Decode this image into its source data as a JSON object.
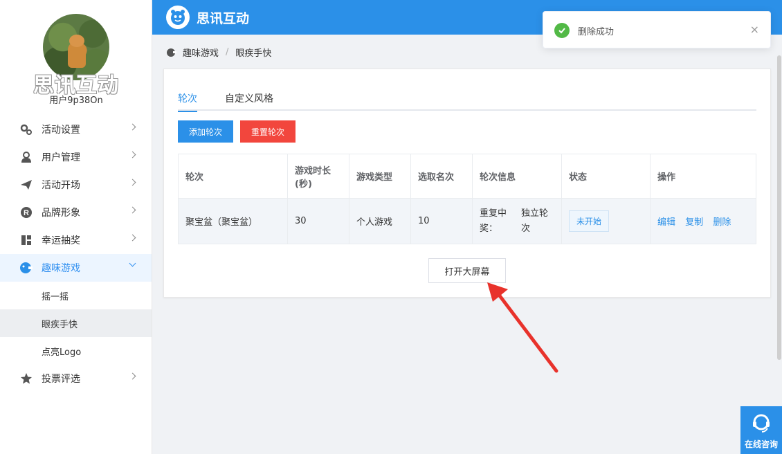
{
  "sidebar": {
    "brand": "思讯互动",
    "username": "用户9p38On",
    "menu": [
      {
        "label": "活动设置",
        "icon": "gears-icon"
      },
      {
        "label": "用户管理",
        "icon": "user-icon"
      },
      {
        "label": "活动开场",
        "icon": "paper-plane-icon"
      },
      {
        "label": "品牌形象",
        "icon": "registered-icon"
      },
      {
        "label": "幸运抽奖",
        "icon": "gift-icon"
      },
      {
        "label": "趣味游戏",
        "icon": "gamepad-icon"
      },
      {
        "label": "投票评选",
        "icon": "star-icon"
      }
    ],
    "submenu": [
      "摇一摇",
      "眼疾手快",
      "点亮Logo"
    ]
  },
  "header": {
    "title": "思讯互动"
  },
  "breadcrumb": {
    "parent": "趣味游戏",
    "separator": "/",
    "current": "眼疾手快"
  },
  "tabs": [
    "轮次",
    "自定义风格"
  ],
  "buttons": {
    "add": "添加轮次",
    "reset": "重置轮次",
    "open_screen": "打开大屏幕"
  },
  "table": {
    "headers": [
      "轮次",
      "游戏时长(秒)",
      "游戏类型",
      "选取名次",
      "轮次信息",
      "状态",
      "操作"
    ],
    "rows": [
      {
        "round": "聚宝盆（聚宝盆）",
        "duration": "30",
        "type": "个人游戏",
        "rank": "10",
        "info_a": "重复中奖：",
        "info_b": "独立轮次",
        "status": "未开始",
        "actions": [
          "编辑",
          "复制",
          "删除"
        ]
      }
    ]
  },
  "toast": {
    "message": "删除成功",
    "close": "×"
  },
  "consult": {
    "label": "在线咨询"
  },
  "colors": {
    "primary": "#2b90e8",
    "danger": "#f2463d",
    "success": "#52b946",
    "annotation": "#e8322b"
  }
}
